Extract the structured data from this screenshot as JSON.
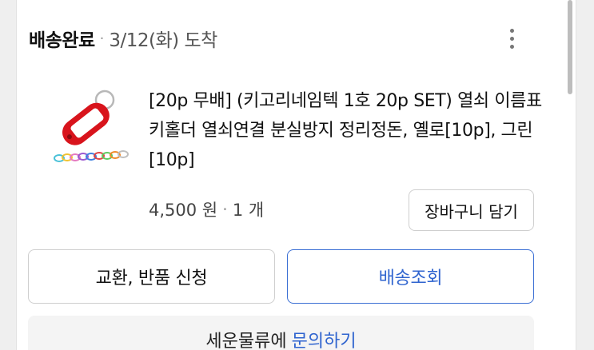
{
  "order": {
    "status": "배송완료",
    "separator": "·",
    "arrival": "3/12(화) 도착"
  },
  "product": {
    "title": "[20p 무배] (키고리네임텍 1호 20p SET) 열쇠 이름표 키홀더 열쇠연결 분실방지 정리정돈, 옐로[10p], 그린[10p]",
    "price": "4,500 원",
    "dot": "·",
    "quantity": "1 개"
  },
  "buttons": {
    "add_to_cart": "장바구니 담기",
    "exchange_return": "교환, 반품 신청",
    "track_delivery": "배송조회"
  },
  "inquiry": {
    "carrier": "세운물류에",
    "link": "문의하기"
  },
  "icons": {
    "more": "more-vertical-icon",
    "thumbnail": "key-tag-product-image"
  },
  "colors": {
    "accent": "#2f64cf",
    "tag_red": "#d8141c"
  }
}
